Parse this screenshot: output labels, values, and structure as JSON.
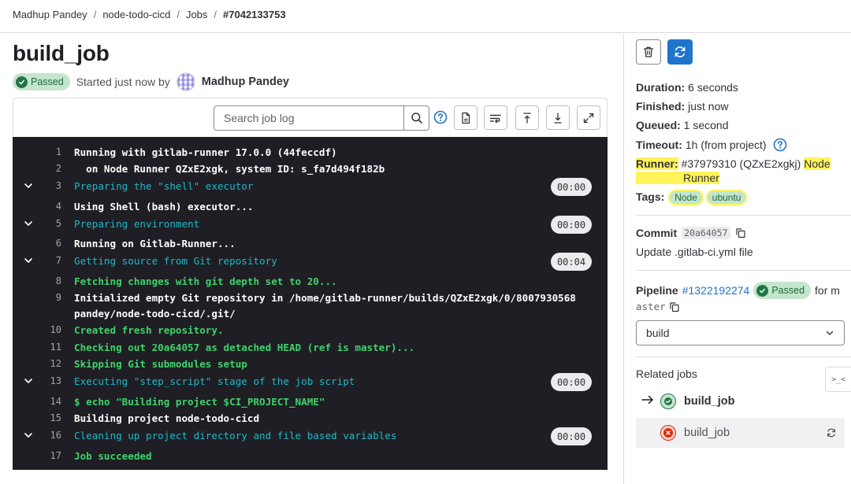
{
  "breadcrumb": [
    "Madhup Pandey",
    "node-todo-cicd",
    "Jobs",
    "#7042133753"
  ],
  "job": {
    "title": "build_job",
    "status": "Passed",
    "started_text": "Started just now by",
    "author": "Madhup Pandey"
  },
  "toolbar": {
    "search_placeholder": "Search job log"
  },
  "log_lines": [
    {
      "n": "1",
      "text": "Running with gitlab-runner 17.0.0 (44feccdf)",
      "color": "white"
    },
    {
      "n": "2",
      "text": "  on Node Runner QZxE2xgk, system ID: s_fa7d494f182b",
      "color": "white"
    },
    {
      "n": "3",
      "text": "Preparing the \"shell\" executor",
      "color": "cyan",
      "section": true,
      "time": "00:00"
    },
    {
      "n": "4",
      "text": "Using Shell (bash) executor...",
      "color": "white"
    },
    {
      "n": "5",
      "text": "Preparing environment",
      "color": "cyan",
      "section": true,
      "time": "00:00"
    },
    {
      "n": "6",
      "text": "Running on Gitlab-Runner...",
      "color": "white"
    },
    {
      "n": "7",
      "text": "Getting source from Git repository",
      "color": "cyan",
      "section": true,
      "time": "00:04"
    },
    {
      "n": "8",
      "text": "Fetching changes with git depth set to 20...",
      "color": "green"
    },
    {
      "n": "9",
      "text": "Initialized empty Git repository in /home/gitlab-runner/builds/QZxE2xgk/0/8007930568",
      "color": "white"
    },
    {
      "n": "",
      "text": "pandey/node-todo-cicd/.git/",
      "color": "white"
    },
    {
      "n": "10",
      "text": "Created fresh repository.",
      "color": "green"
    },
    {
      "n": "11",
      "text": "Checking out 20a64057 as detached HEAD (ref is master)...",
      "color": "green"
    },
    {
      "n": "12",
      "text": "Skipping Git submodules setup",
      "color": "green"
    },
    {
      "n": "13",
      "text": "Executing \"step_script\" stage of the job script",
      "color": "cyan",
      "section": true,
      "time": "00:00"
    },
    {
      "n": "14",
      "text": "$ echo \"Building project $CI_PROJECT_NAME\"",
      "color": "green"
    },
    {
      "n": "15",
      "text": "Building project node-todo-cicd",
      "color": "white"
    },
    {
      "n": "16",
      "text": "Cleaning up project directory and file based variables",
      "color": "cyan",
      "section": true,
      "time": "00:00"
    },
    {
      "n": "17",
      "text": "Job succeeded",
      "color": "green"
    }
  ],
  "sidebar": {
    "duration_label": "Duration:",
    "duration": "6 seconds",
    "finished_label": "Finished:",
    "finished": "just now",
    "queued_label": "Queued:",
    "queued": "1 second",
    "timeout_label": "Timeout:",
    "timeout": "1h (from project)",
    "runner_label": "Runner:",
    "runner_id": "#37979310 (QZxE2xgkj)",
    "runner_name_1": "Node",
    "runner_name_2": "Runner",
    "tags_label": "Tags:",
    "tags": [
      "Node",
      "ubuntu"
    ],
    "commit_label": "Commit",
    "commit_sha": "20a64057",
    "commit_message": "Update .gitlab-ci.yml file",
    "pipeline_label": "Pipeline",
    "pipeline_id": "#1322192274",
    "pipeline_status": "Passed",
    "pipeline_for": "for m",
    "pipeline_ref": "aster",
    "stage_select": "build",
    "related_jobs_label": "Related jobs",
    "related_jobs": [
      {
        "name": "build_job",
        "status": "passed",
        "current": true
      },
      {
        "name": "build_job",
        "status": "failed",
        "current": false
      }
    ]
  },
  "colors": {
    "passed_green": "#217645",
    "failed_red": "#dd2b0e",
    "link_blue": "#1f75cb",
    "highlight_yellow": "#fef45a",
    "log_bg": "#1f1e24"
  }
}
